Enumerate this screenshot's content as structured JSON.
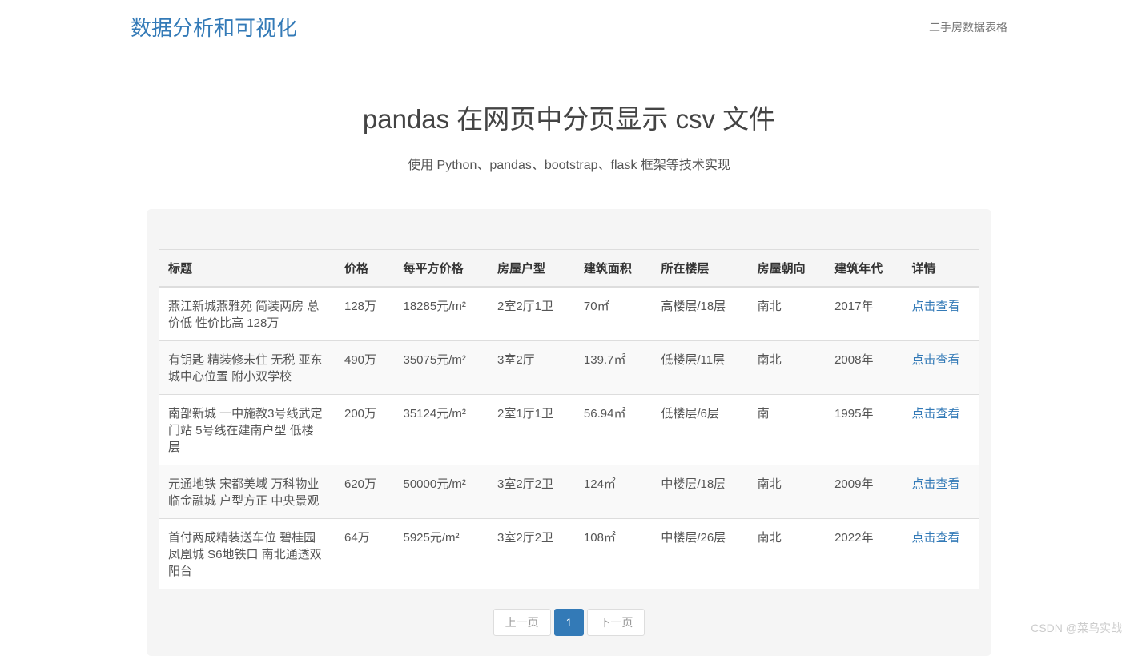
{
  "nav": {
    "brand": "数据分析和可视化",
    "link": "二手房数据表格"
  },
  "hero": {
    "title": "pandas 在网页中分页显示 csv 文件",
    "subtitle": "使用 Python、pandas、bootstrap、flask 框架等技术实现"
  },
  "table": {
    "headers": [
      "标题",
      "价格",
      "每平方价格",
      "房屋户型",
      "建筑面积",
      "所在楼层",
      "房屋朝向",
      "建筑年代",
      "详情"
    ],
    "detail_label": "点击查看",
    "rows": [
      {
        "title": "燕江新城燕雅苑 简装两房 总价低 性价比高 128万",
        "price": "128万",
        "ppm": "18285元/m²",
        "layout": "2室2厅1卫",
        "area": "70㎡",
        "floor": "高楼层/18层",
        "dir": "南北",
        "year": "2017年"
      },
      {
        "title": "有钥匙 精装修未住 无税 亚东城中心位置 附小双学校",
        "price": "490万",
        "ppm": "35075元/m²",
        "layout": "3室2厅",
        "area": "139.7㎡",
        "floor": "低楼层/11层",
        "dir": "南北",
        "year": "2008年"
      },
      {
        "title": "南部新城 一中施教3号线武定门站 5号线在建南户型 低楼层",
        "price": "200万",
        "ppm": "35124元/m²",
        "layout": "2室1厅1卫",
        "area": "56.94㎡",
        "floor": "低楼层/6层",
        "dir": "南",
        "year": "1995年"
      },
      {
        "title": "元通地铁 宋都美域 万科物业 临金融城 户型方正 中央景观",
        "price": "620万",
        "ppm": "50000元/m²",
        "layout": "3室2厅2卫",
        "area": "124㎡",
        "floor": "中楼层/18层",
        "dir": "南北",
        "year": "2009年"
      },
      {
        "title": "首付两成精装送车位 碧桂园凤凰城 S6地铁口 南北通透双阳台",
        "price": "64万",
        "ppm": "5925元/m²",
        "layout": "3室2厅2卫",
        "area": "108㎡",
        "floor": "中楼层/26层",
        "dir": "南北",
        "year": "2022年"
      }
    ]
  },
  "pagination": {
    "prev": "上一页",
    "current": "1",
    "next": "下一页"
  },
  "watermark": "CSDN @菜鸟实战"
}
